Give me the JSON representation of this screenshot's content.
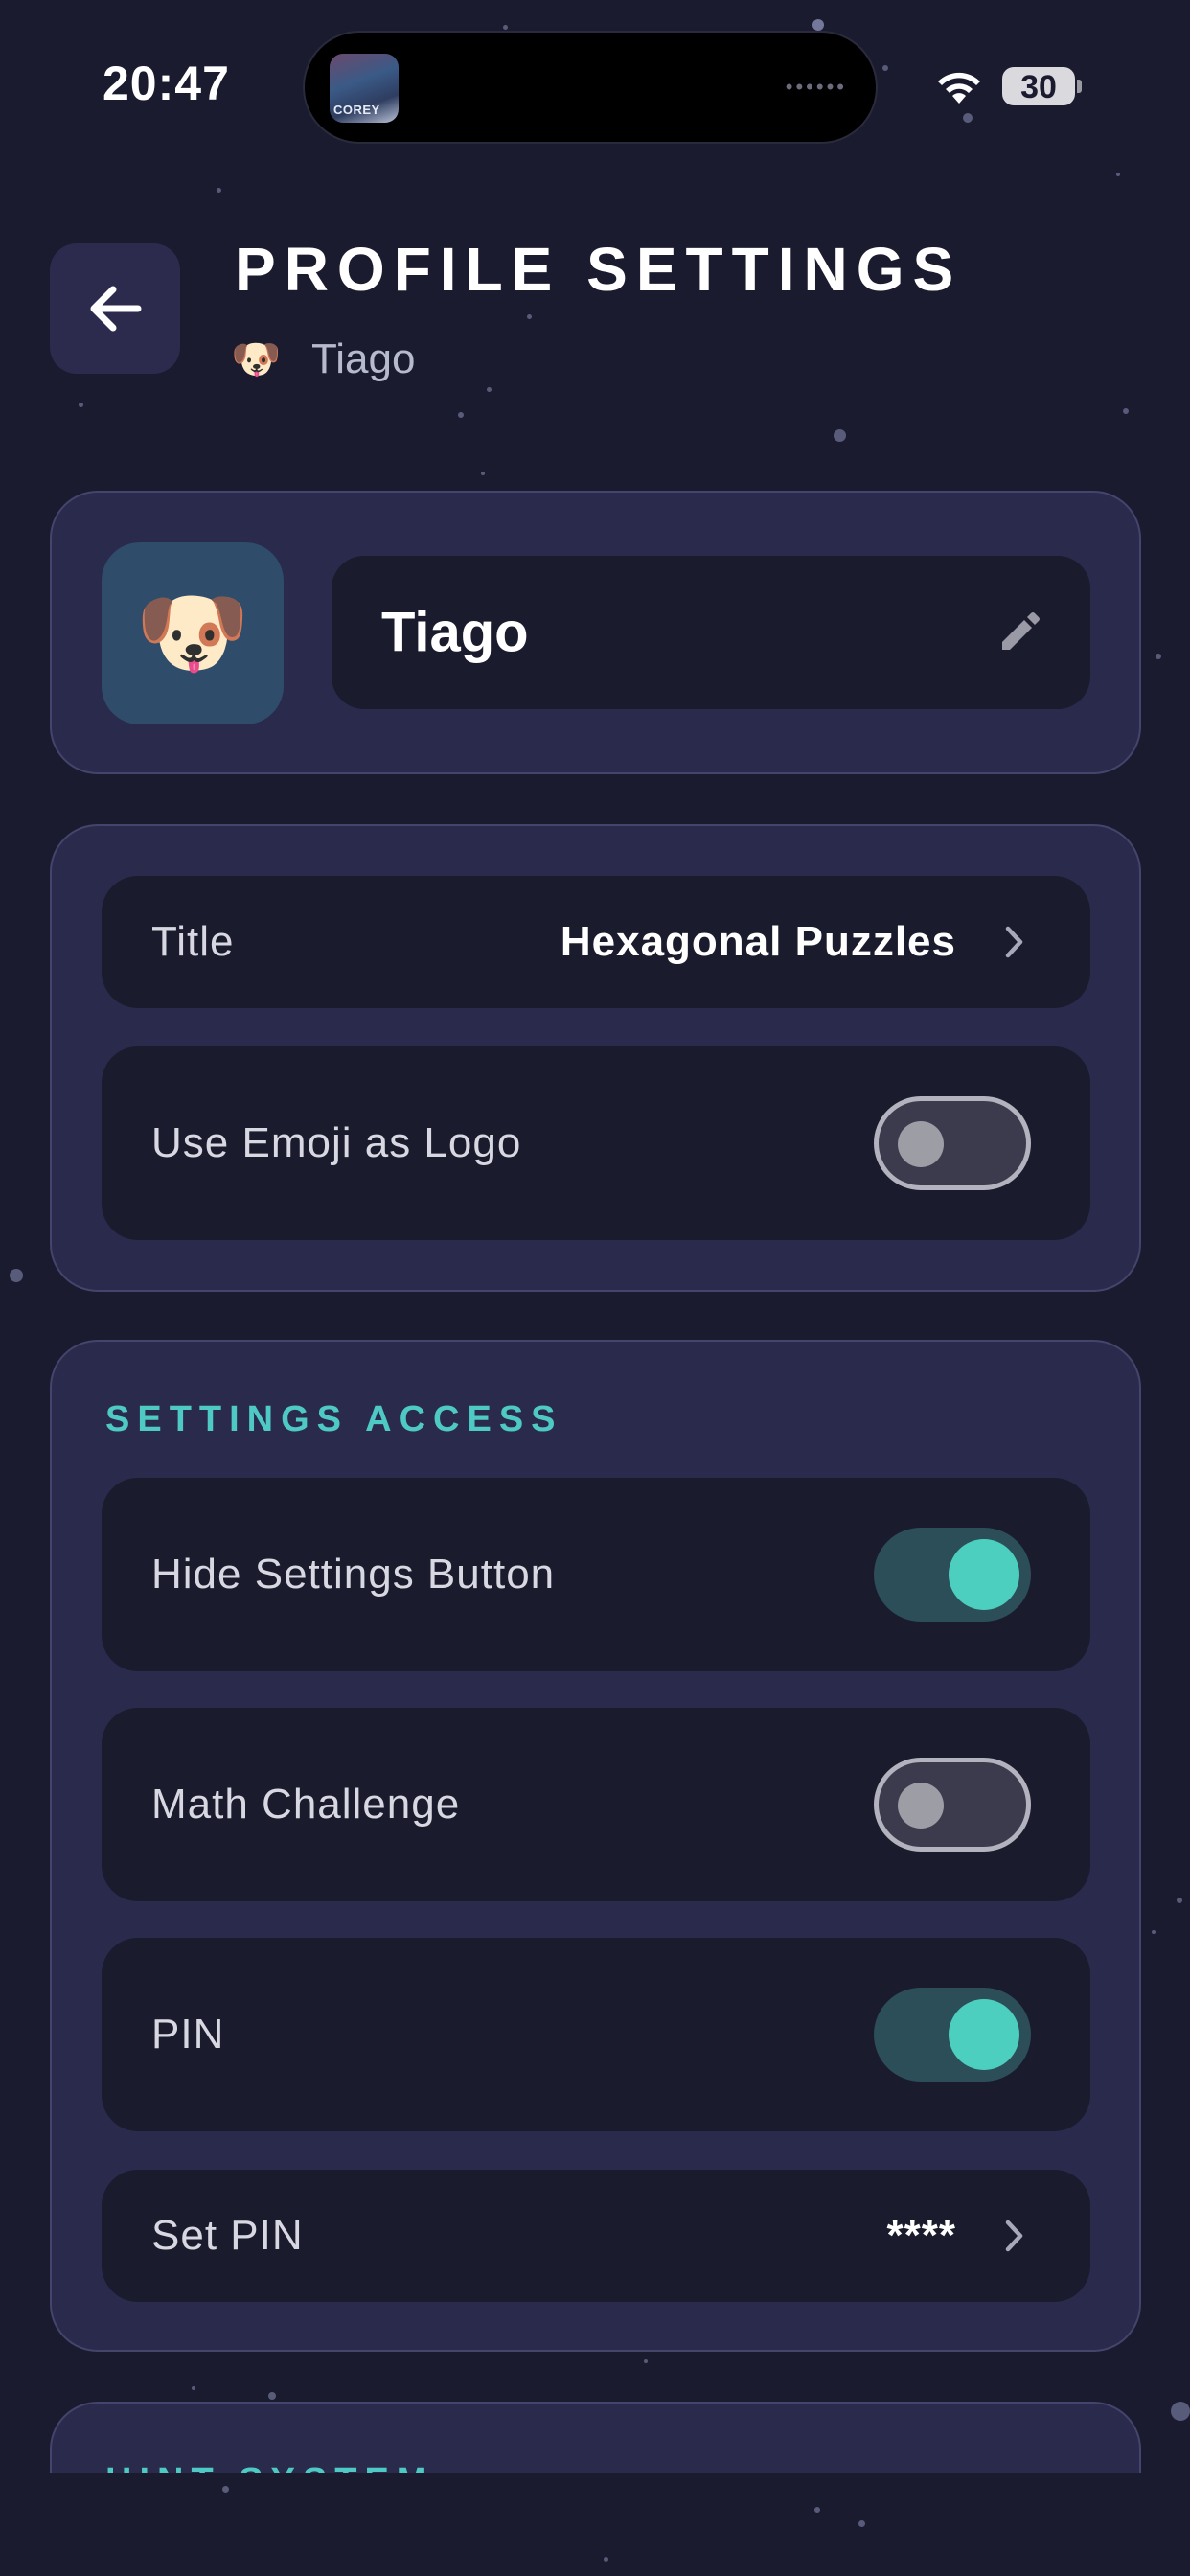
{
  "status_bar": {
    "time": "20:47",
    "battery": "30",
    "wifi_icon": "wifi-icon",
    "now_playing_art_text": "COREY"
  },
  "header": {
    "title": "PROFILE SETTINGS",
    "profile_emoji": "🐶",
    "profile_name": "Tiago",
    "back_icon": "arrow-left-icon"
  },
  "profile_card": {
    "avatar_emoji": "🐶",
    "name": "Tiago",
    "edit_icon": "pencil-icon"
  },
  "general_card": {
    "rows": [
      {
        "label": "Title",
        "value": "Hexagonal Puzzles",
        "type": "link"
      },
      {
        "label": "Use Emoji as Logo",
        "type": "toggle",
        "on": false
      }
    ]
  },
  "settings_access": {
    "heading": "SETTINGS ACCESS",
    "rows": [
      {
        "label": "Hide Settings Button",
        "type": "toggle",
        "on": true
      },
      {
        "label": "Math Challenge",
        "type": "toggle",
        "on": false
      },
      {
        "label": "PIN",
        "type": "toggle",
        "on": true
      },
      {
        "label": "Set PIN",
        "value": "****",
        "type": "link"
      }
    ]
  },
  "hint_system": {
    "heading": "HINT SYSTEM"
  },
  "colors": {
    "background": "#1b1b2f",
    "card": "#2a2a4c",
    "row": "#1b1b2e",
    "accent": "#4ccfbf",
    "section_heading": "#4fc9c3"
  }
}
